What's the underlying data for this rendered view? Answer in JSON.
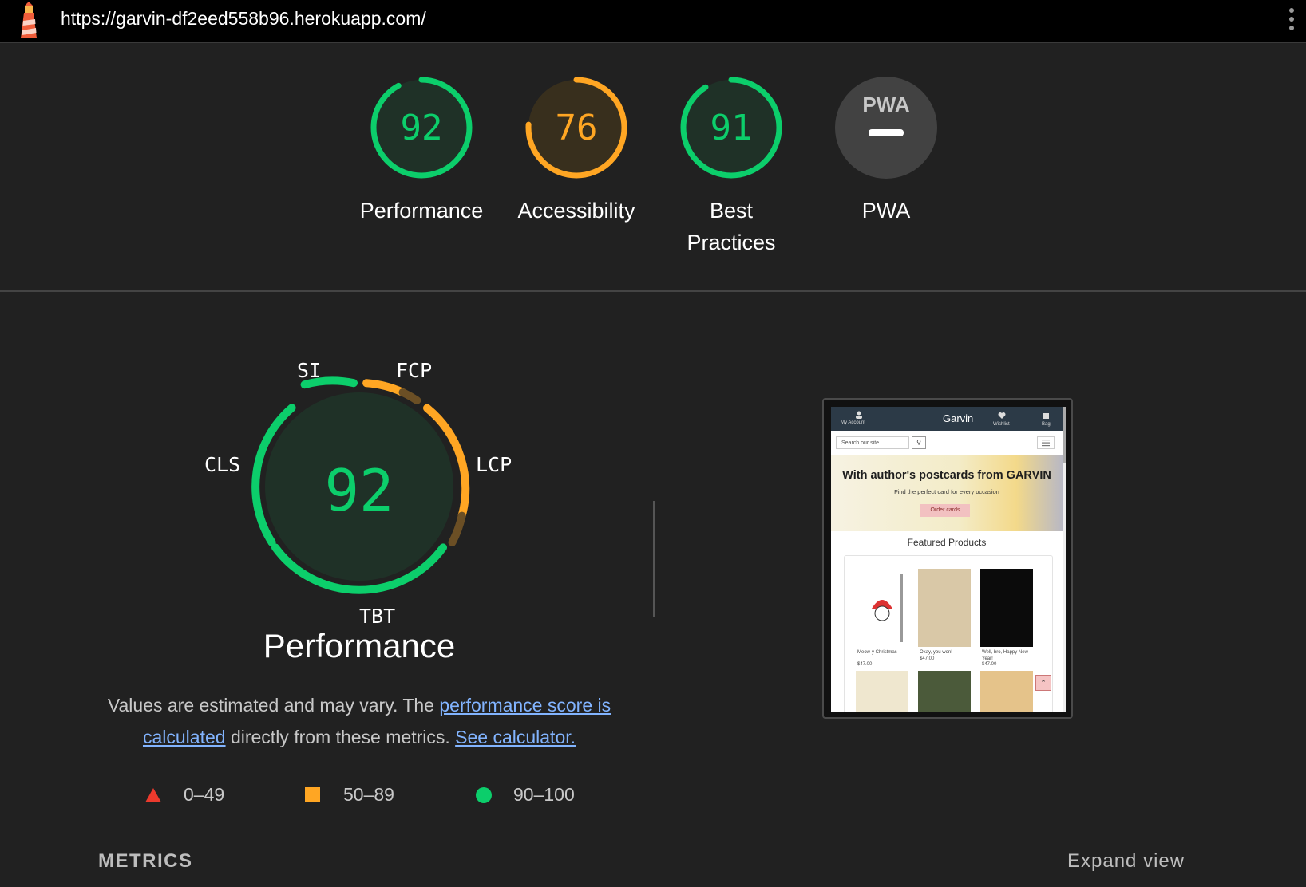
{
  "topbar": {
    "url": "https://garvin-df2eed558b96.herokuapp.com/",
    "logo_icon": "lighthouse-icon",
    "menu_icon": "kebab-menu-icon"
  },
  "categories": [
    {
      "label": "Performance",
      "score": 92,
      "status": "pass"
    },
    {
      "label": "Accessibility",
      "score": 76,
      "status": "average"
    },
    {
      "label": "Best Practices",
      "score": 91,
      "status": "pass"
    },
    {
      "label": "PWA",
      "score": null,
      "status": "na",
      "badge_text": "PWA"
    }
  ],
  "performance": {
    "score": 92,
    "title": "Performance",
    "metric_labels": {
      "si": "SI",
      "fcp": "FCP",
      "lcp": "LCP",
      "tbt": "TBT",
      "cls": "CLS"
    },
    "description_prefix": "Values are estimated and may vary. The ",
    "link_score": "performance score is calculated",
    "description_middle": " directly from these metrics. ",
    "link_calculator": "See calculator."
  },
  "legend": [
    {
      "range": "0–49",
      "shape": "triangle",
      "color": "#eb3a2d"
    },
    {
      "range": "50–89",
      "shape": "square",
      "color": "#ffa623"
    },
    {
      "range": "90–100",
      "shape": "circle",
      "color": "#0cce6b"
    }
  ],
  "colors": {
    "pass": "#0cce6b",
    "average": "#ffa623",
    "fail": "#eb3a2d",
    "background": "#212121"
  },
  "screenshot": {
    "account": "My Account",
    "brand": "Garvin",
    "wishlist": "Wishlist",
    "bag": "Bag",
    "search_placeholder": "Search our site",
    "hero_title": "With author's postcards from GARVIN",
    "hero_sub": "Find the perfect card for every occasion",
    "hero_cta": "Order cards",
    "featured": "Featured Products",
    "products": [
      {
        "name": "Meow-y Christmas",
        "price": "$47.00"
      },
      {
        "name": "Okay, you won!",
        "price": "$47.00"
      },
      {
        "name": "Well, bro, Happy New Year!",
        "price": "$47.00"
      }
    ]
  },
  "metrics": {
    "heading": "METRICS",
    "expand": "Expand view"
  }
}
